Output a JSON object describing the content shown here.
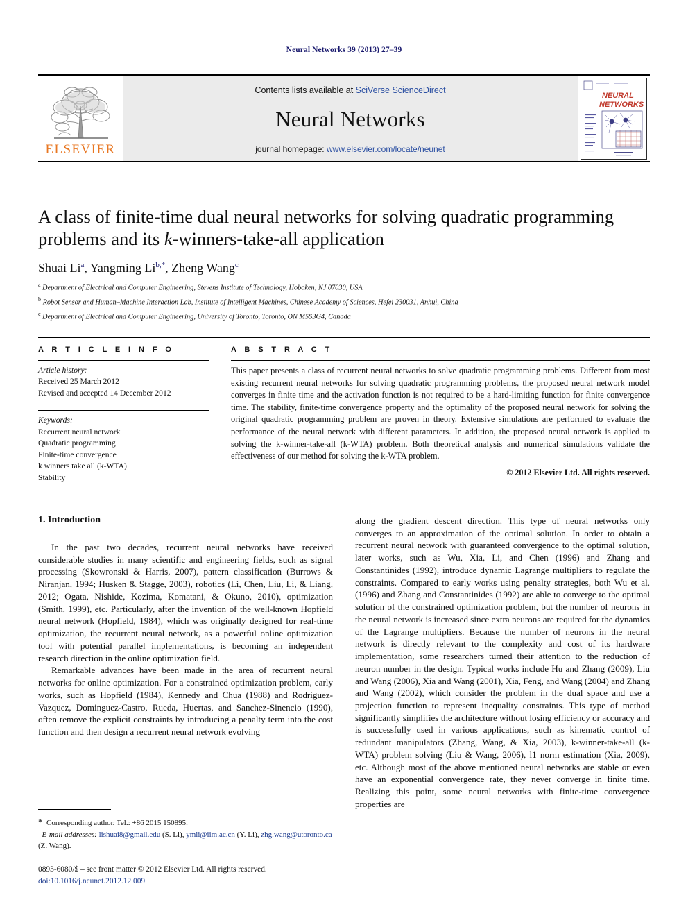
{
  "running_head": "Neural Networks 39 (2013) 27–39",
  "masthead": {
    "publisher_logo_label": "ELSEVIER",
    "contents_prefix": "Contents lists available at ",
    "contents_link": "SciVerse ScienceDirect",
    "journal_name": "Neural Networks",
    "homepage_prefix": "journal homepage: ",
    "homepage_url": "www.elsevier.com/locate/neunet",
    "cover_title_line1": "NEURAL",
    "cover_title_line2": "NETWORKS"
  },
  "article": {
    "title_part1": "A class of finite-time dual neural networks for solving quadratic programming problems and its ",
    "title_italic": "k",
    "title_part2": "-winners-take-all application",
    "authors": [
      {
        "name": "Shuai Li",
        "sup": "a"
      },
      {
        "name": "Yangming Li",
        "sup": "b,*"
      },
      {
        "name": "Zheng Wang",
        "sup": "c"
      }
    ],
    "affiliations": [
      {
        "mark": "a",
        "text": "Department of Electrical and Computer Engineering, Stevens Institute of Technology, Hoboken, NJ 07030, USA"
      },
      {
        "mark": "b",
        "text": "Robot Sensor and Human–Machine Interaction Lab, Institute of Intelligent Machines, Chinese Academy of Sciences, Hefei 230031, Anhui, China"
      },
      {
        "mark": "c",
        "text": "Department of Electrical and Computer Engineering, University of Toronto, Toronto, ON M5S3G4, Canada"
      }
    ]
  },
  "article_info": {
    "heading": "A R T I C L E   I N F O",
    "history_label": "Article history:",
    "history_lines": [
      "Received 25 March 2012",
      "Revised and accepted 14 December 2012"
    ],
    "keywords_label": "Keywords:",
    "keywords": [
      "Recurrent neural network",
      "Quadratic programming",
      "Finite-time convergence",
      "k winners take all (k-WTA)",
      "Stability"
    ]
  },
  "abstract": {
    "heading": "A B S T R A C T",
    "text": "This paper presents a class of recurrent neural networks to solve quadratic programming problems. Different from most existing recurrent neural networks for solving quadratic programming problems, the proposed neural network model converges in finite time and the activation function is not required to be a hard-limiting function for finite convergence time. The stability, finite-time convergence property and the optimality of the proposed neural network for solving the original quadratic programming problem are proven in theory. Extensive simulations are performed to evaluate the performance of the neural network with different parameters. In addition, the proposed neural network is applied to solving the k-winner-take-all (k-WTA) problem. Both theoretical analysis and numerical simulations validate the effectiveness of our method for solving the k-WTA problem.",
    "copyright": "© 2012 Elsevier Ltd. All rights reserved."
  },
  "body": {
    "section_heading": "1. Introduction",
    "left_paragraphs": [
      "In the past two decades, recurrent neural networks have received considerable studies in many scientific and engineering fields, such as signal processing (Skowronski & Harris, 2007), pattern classification (Burrows & Niranjan, 1994; Husken & Stagge, 2003), robotics (Li, Chen, Liu, Li, & Liang, 2012; Ogata, Nishide, Kozima, Komatani, & Okuno, 2010), optimization (Smith, 1999), etc. Particularly, after the invention of the well-known Hopfield neural network (Hopfield, 1984), which was originally designed for real-time optimization, the recurrent neural network, as a powerful online optimization tool with potential parallel implementations, is becoming an independent research direction in the online optimization field.",
      "Remarkable advances have been made in the area of recurrent neural networks for online optimization. For a constrained optimization problem, early works, such as Hopfield (1984), Kennedy and Chua (1988) and Rodriguez-Vazquez, Dominguez-Castro, Rueda, Huertas, and Sanchez-Sinencio (1990), often remove the explicit constraints by introducing a penalty term into the cost function and then design a recurrent neural network evolving"
    ],
    "right_paragraphs": [
      "along the gradient descent direction. This type of neural networks only converges to an approximation of the optimal solution. In order to obtain a recurrent neural network with guaranteed convergence to the optimal solution, later works, such as Wu, Xia, Li, and Chen (1996) and Zhang and Constantinides (1992), introduce dynamic Lagrange multipliers to regulate the constraints. Compared to early works using penalty strategies, both Wu et al. (1996) and Zhang and Constantinides (1992) are able to converge to the optimal solution of the constrained optimization problem, but the number of neurons in the neural network is increased since extra neurons are required for the dynamics of the Lagrange multipliers. Because the number of neurons in the neural network is directly relevant to the complexity and cost of its hardware implementation, some researchers turned their attention to the reduction of neuron number in the design. Typical works include Hu and Zhang (2009), Liu and Wang (2006), Xia and Wang (2001), Xia, Feng, and Wang (2004) and Zhang and Wang (2002), which consider the problem in the dual space and use a projection function to represent inequality constraints. This type of method significantly simplifies the architecture without losing efficiency or accuracy and is successfully used in various applications, such as kinematic control of redundant manipulators (Zhang, Wang, & Xia, 2003), k-winner-take-all (k-WTA) problem solving (Liu & Wang, 2006), l1 norm estimation (Xia, 2009), etc. Although most of the above mentioned neural networks are stable or even have an exponential convergence rate, they never converge in finite time. Realizing this point, some neural networks with finite-time convergence properties are"
    ]
  },
  "footnote": {
    "corresponding": "Corresponding author. Tel.: +86 2015 150895.",
    "email_label": "E-mail addresses:",
    "emails": [
      {
        "address": "lishuai8@gmail.edu",
        "owner": "(S. Li)"
      },
      {
        "address": "ymli@iim.ac.cn",
        "owner": "(Y. Li)"
      },
      {
        "address": "zhg.wang@utoronto.ca",
        "owner": "(Z. Wang)"
      }
    ]
  },
  "imprint": {
    "line1": "0893-6080/$ – see front matter © 2012 Elsevier Ltd. All rights reserved.",
    "doi": "doi:10.1016/j.neunet.2012.12.009"
  },
  "colors": {
    "link_blue": "#2b4fa2",
    "ref_blue": "#1f3d8f",
    "elsevier_orange": "#E87722",
    "masthead_grey": "#ebebeb"
  }
}
